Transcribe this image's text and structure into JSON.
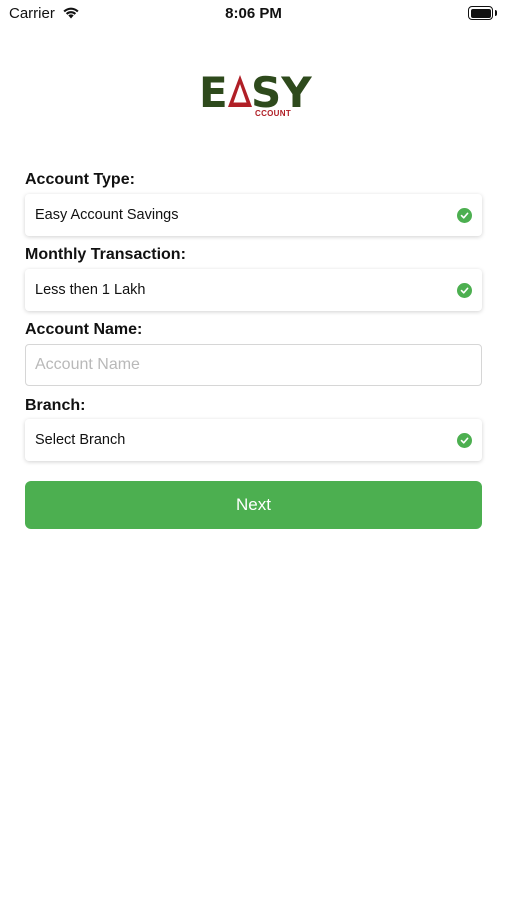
{
  "status_bar": {
    "carrier": "Carrier",
    "time": "8:06 PM",
    "wifi_icon": "wifi-icon",
    "battery_icon": "battery-icon"
  },
  "logo": {
    "letter_e": "E",
    "letters_sy": "SY",
    "subtitle": "CCOUNT",
    "brand_green": "#2e4a1c",
    "brand_red": "#b01f26"
  },
  "form": {
    "account_type": {
      "label": "Account Type:",
      "value": "Easy Account Savings",
      "icon": "check-circle-icon"
    },
    "monthly_transaction": {
      "label": "Monthly Transaction:",
      "value": "Less then 1 Lakh",
      "icon": "check-circle-icon"
    },
    "account_name": {
      "label": "Account Name:",
      "value": "",
      "placeholder": "Account Name"
    },
    "branch": {
      "label": "Branch:",
      "value": "Select Branch",
      "icon": "check-circle-icon"
    }
  },
  "next_button": {
    "label": "Next"
  },
  "colors": {
    "accent": "#4caf50"
  }
}
